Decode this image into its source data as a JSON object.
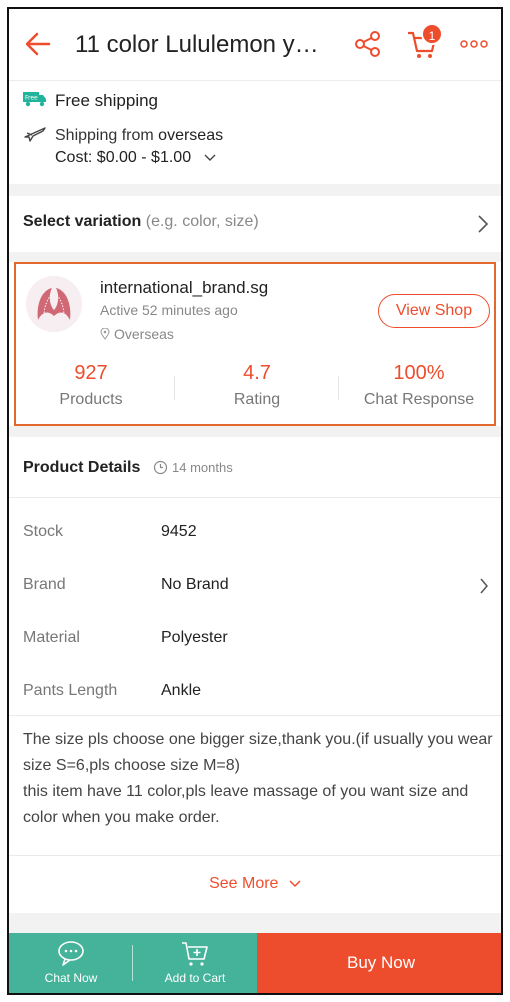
{
  "header": {
    "title": "11 color Lululemon y…",
    "cart_count": "1"
  },
  "shipping": {
    "free_label": "Free shipping",
    "badge": "Free",
    "from_prefix": "Shipping from ",
    "from_value": "overseas",
    "cost": "Cost: $0.00 - $1.00"
  },
  "variation": {
    "label": "Select variation",
    "hint": "(e.g. color, size)"
  },
  "shop": {
    "name": "international_brand.sg",
    "active": "Active 52 minutes ago",
    "location": "Overseas",
    "view_button": "View Shop",
    "stats": [
      {
        "value": "927",
        "label": "Products"
      },
      {
        "value": "4.7",
        "label": "Rating"
      },
      {
        "value": "100%",
        "label": "Chat Response"
      }
    ]
  },
  "details": {
    "heading": "Product Details",
    "age": "14 months",
    "rows": [
      {
        "label": "Stock",
        "value": "9452"
      },
      {
        "label": "Brand",
        "value": "No Brand"
      },
      {
        "label": "Material",
        "value": "Polyester"
      },
      {
        "label": "Pants Length",
        "value": "Ankle"
      }
    ],
    "description": "The size pls choose one bigger size,thank you.(if usually you wear size S=6,pls choose size M=8)\nthis item have 11 color,pls leave massage of you want size and color when you make order.",
    "see_more": "See More"
  },
  "bottom_bar": {
    "chat": "Chat Now",
    "add_cart": "Add to Cart",
    "buy": "Buy Now"
  },
  "colors": {
    "accent": "#ee4d2d",
    "chat_bg": "#45b39a",
    "highlight_border": "#e2692b"
  }
}
